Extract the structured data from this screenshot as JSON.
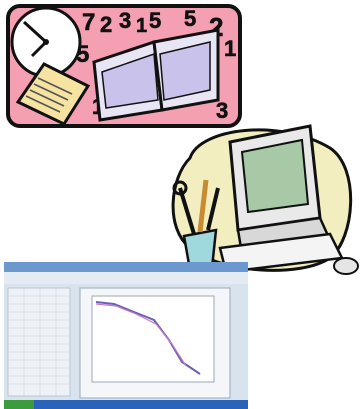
{
  "clipart_study": {
    "numbers": [
      "7",
      "2",
      "3",
      "1",
      "5",
      "5",
      "2",
      "1",
      "5",
      "1",
      "3"
    ],
    "colors": {
      "panel": "#f4a0b2",
      "border": "#111111",
      "paper": "#f6e3a1",
      "book": "#c9c2ea",
      "book_pages": "#e8e6f5"
    }
  },
  "clipart_computer": {
    "colors": {
      "blob": "#f2eec0",
      "monitor": "#e9e9e9",
      "screen": "#a8c9a5",
      "cup": "#9fd8dd"
    }
  },
  "screenshot_thumbnail": {
    "colors": {
      "window_bg": "#d9e3ee",
      "title_bar": "#6b98cf",
      "taskbar": "#2a63b9",
      "grid": "#eef2f6",
      "plot_bg": "#f4f6f9",
      "curve": "#6a60b8"
    }
  }
}
